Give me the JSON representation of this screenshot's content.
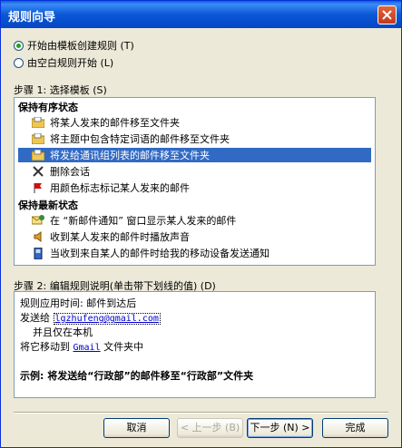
{
  "window": {
    "title": "规则向导"
  },
  "options": [
    {
      "label": "开始由模板创建规则 (T)",
      "selected": true
    },
    {
      "label": "由空白规则开始 (L)",
      "selected": false
    }
  ],
  "step1": {
    "label": "步骤 1: 选择模板 (S)",
    "groups": [
      {
        "title": "保持有序状态",
        "items": [
          {
            "label": "将某人发来的邮件移至文件夹",
            "icon": "folder-icon"
          },
          {
            "label": "将主题中包含特定词语的邮件移至文件夹",
            "icon": "folder-icon"
          },
          {
            "label": "将发给通讯组列表的邮件移至文件夹",
            "icon": "folder-icon",
            "selected": true
          },
          {
            "label": "删除会话",
            "icon": "delete-icon"
          },
          {
            "label": "用颜色标志标记某人发来的邮件",
            "icon": "flag-icon"
          }
        ]
      },
      {
        "title": "保持最新状态",
        "items": [
          {
            "label": "在 “新邮件通知” 窗口显示某人发来的邮件",
            "icon": "alert-icon"
          },
          {
            "label": "收到某人发来的邮件时播放声音",
            "icon": "sound-icon"
          },
          {
            "label": "当收到来自某人的邮件时给我的移动设备发送通知",
            "icon": "mobile-icon"
          }
        ]
      }
    ]
  },
  "step2": {
    "label": "步骤 2: 编辑规则说明(单击带下划线的值) (D)",
    "lines": {
      "l1": "规则应用时间: 邮件到达后",
      "l2_prefix": "发送给",
      "l2_link": "lgzhufeng@gmail.com",
      "l3": "并且仅在本机",
      "l4_prefix": "将它移动到",
      "l4_link": "Gmail",
      "l4_suffix": "文件夹中",
      "example": "示例: 将发送给“行政部”的邮件移至“行政部”文件夹"
    }
  },
  "buttons": {
    "cancel": "取消",
    "back": "< 上一步 (B)",
    "next": "下一步 (N) >",
    "finish": "完成"
  },
  "colors": {
    "selection": "#316ac5",
    "link": "#0000cc",
    "titlebar": "#0a58d6"
  }
}
